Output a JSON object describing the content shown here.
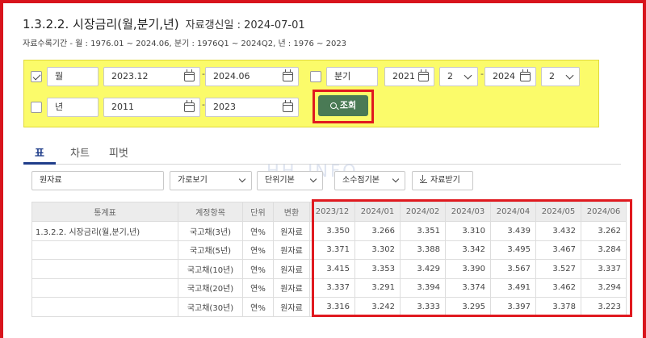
{
  "header": {
    "title": "1.3.2.2. 시장금리(월,분기,년)",
    "updated": "자료갱신일 : 2024-07-01",
    "range": "자료수록기간 - 월 : 1976.01 ~ 2024.06, 분기 : 1976Q1 ~ 2024Q2, 년 : 1976 ~ 2023"
  },
  "filters": {
    "monthly": {
      "checked": true,
      "label": "월",
      "from": "2023.12",
      "to": "2024.06"
    },
    "quarterly": {
      "checked": false,
      "label": "분기",
      "from_year": "2021",
      "from_q": "2",
      "to_year": "2024",
      "to_q": "2"
    },
    "yearly": {
      "checked": false,
      "label": "년",
      "from": "2011",
      "to": "2023"
    },
    "dash": "-",
    "search_label": "조회"
  },
  "tabs": [
    "표",
    "차트",
    "피벗"
  ],
  "watermark": "HH_INFO",
  "toolbar": {
    "data_type": "원자료",
    "view": "가로보기",
    "unit": "단위기본",
    "decimal": "소수점기본",
    "download": "자료받기"
  },
  "table": {
    "headers": [
      "통계표",
      "계정항목",
      "단위",
      "변환",
      "2023/12",
      "2024/01",
      "2024/02",
      "2024/03",
      "2024/04",
      "2024/05",
      "2024/06"
    ],
    "stat_name": "1.3.2.2. 시장금리(월,분기,년)",
    "rows": [
      {
        "item": "국고채(3년)",
        "unit": "연%",
        "conv": "원자료",
        "values": [
          "3.350",
          "3.266",
          "3.351",
          "3.310",
          "3.439",
          "3.432",
          "3.262"
        ]
      },
      {
        "item": "국고채(5년)",
        "unit": "연%",
        "conv": "원자료",
        "values": [
          "3.371",
          "3.302",
          "3.388",
          "3.342",
          "3.495",
          "3.467",
          "3.284"
        ]
      },
      {
        "item": "국고채(10년)",
        "unit": "연%",
        "conv": "원자료",
        "values": [
          "3.415",
          "3.353",
          "3.429",
          "3.390",
          "3.567",
          "3.527",
          "3.337"
        ]
      },
      {
        "item": "국고채(20년)",
        "unit": "연%",
        "conv": "원자료",
        "values": [
          "3.337",
          "3.291",
          "3.394",
          "3.374",
          "3.491",
          "3.462",
          "3.294"
        ]
      },
      {
        "item": "국고채(30년)",
        "unit": "연%",
        "conv": "원자료",
        "values": [
          "3.316",
          "3.242",
          "3.333",
          "3.295",
          "3.397",
          "3.378",
          "3.223"
        ]
      }
    ]
  }
}
